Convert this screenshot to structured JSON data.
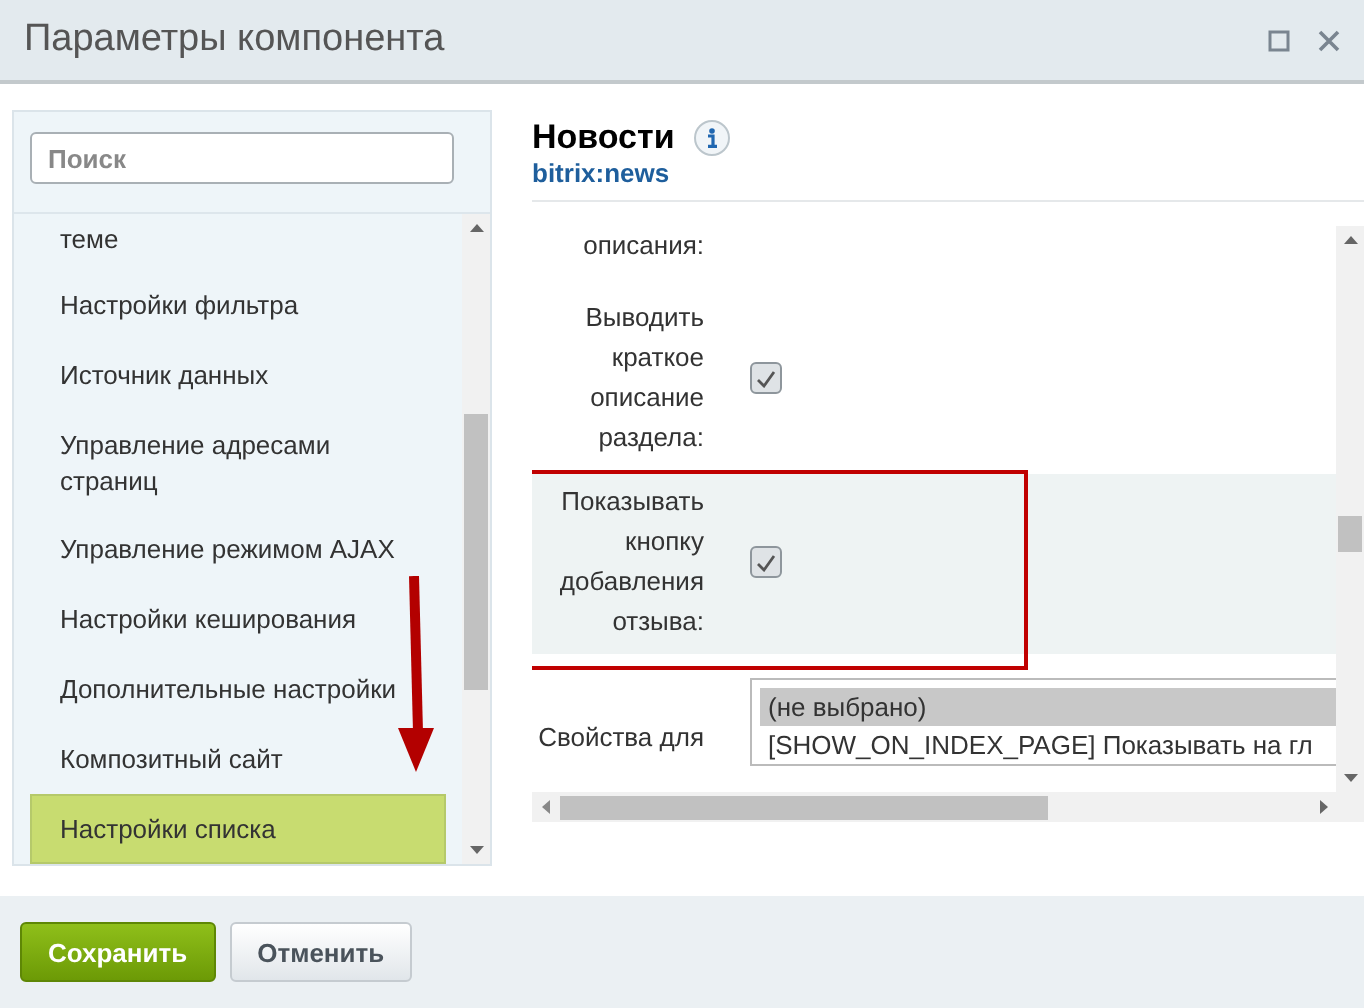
{
  "window": {
    "title": "Параметры компонента"
  },
  "sidebar": {
    "search": {
      "placeholder": "Поиск"
    },
    "items": [
      {
        "label": "теме",
        "selected": false
      },
      {
        "label": "Настройки фильтра",
        "selected": false
      },
      {
        "label": "Источник данных",
        "selected": false
      },
      {
        "label": "Управление адресами страниц",
        "selected": false
      },
      {
        "label": "Управление режимом AJAX",
        "selected": false
      },
      {
        "label": "Настройки кеширования",
        "selected": false
      },
      {
        "label": "Дополнительные настройки",
        "selected": false
      },
      {
        "label": "Композитный сайт",
        "selected": false
      },
      {
        "label": "Настройки списка",
        "selected": true
      }
    ]
  },
  "component": {
    "name": "Новости",
    "code": "bitrix:news"
  },
  "settings": [
    {
      "kind": "label",
      "label": "описания:",
      "highlighted": false
    },
    {
      "kind": "checkbox",
      "label": "Выводить краткое описание раздела:",
      "checked": true,
      "highlighted": false
    },
    {
      "kind": "checkbox",
      "label": "Показывать кнопку добавления отзыва:",
      "checked": true,
      "highlighted": true
    },
    {
      "kind": "multiselect",
      "label": "Свойства для",
      "highlighted": false,
      "options": [
        {
          "label": "(не выбрано)",
          "selected": true
        },
        {
          "label": "[SHOW_ON_INDEX_PAGE] Показывать на гл",
          "selected": false
        }
      ]
    }
  ],
  "buttons": [
    {
      "label": "Сохранить",
      "kind": "primary"
    },
    {
      "label": "Отменить",
      "kind": "secondary"
    }
  ]
}
